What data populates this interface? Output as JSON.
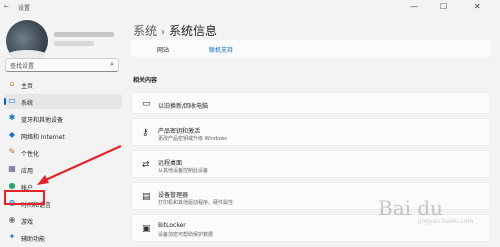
{
  "window": {
    "title": "设置",
    "back_glyph": "←",
    "minimize": "—",
    "maximize": "☐",
    "close": "✕"
  },
  "sidebar": {
    "search_placeholder": "查找设置",
    "items": [
      {
        "label": "主页",
        "icon": "home-icon",
        "glyph": "⌂",
        "color": "#d9822b"
      },
      {
        "label": "系统",
        "icon": "monitor-icon",
        "glyph": "▭",
        "color": "#0078d4"
      },
      {
        "label": "蓝牙和其他设备",
        "icon": "bluetooth-icon",
        "glyph": "✱",
        "color": "#0078d4"
      },
      {
        "label": "网络和 Internet",
        "icon": "wifi-icon",
        "glyph": "◆",
        "color": "#1a73c8"
      },
      {
        "label": "个性化",
        "icon": "paintbrush-icon",
        "glyph": "✎",
        "color": "#c06a2b"
      },
      {
        "label": "应用",
        "icon": "apps-icon",
        "glyph": "▦",
        "color": "#5a5a8a"
      },
      {
        "label": "帐户",
        "icon": "account-icon",
        "glyph": "●",
        "color": "#2fa36b"
      },
      {
        "label": "时间和语言",
        "icon": "globe-icon",
        "glyph": "◍",
        "color": "#1a73c8"
      },
      {
        "label": "游戏",
        "icon": "gamepad-icon",
        "glyph": "◉",
        "color": "#777777"
      },
      {
        "label": "辅助功能",
        "icon": "accessibility-icon",
        "glyph": "✦",
        "color": "#1a73c8"
      }
    ],
    "active_index": 1,
    "highlighted_index": 6
  },
  "main": {
    "breadcrumb_root": "系统",
    "breadcrumb_sep": "›",
    "breadcrumb_current": "系统信息",
    "site_key": "网站",
    "site_value": "联机支持",
    "section_title": "相关内容",
    "cards": [
      {
        "title": "以旧换新/回收电脑",
        "sub": "",
        "icon": "laptop-icon",
        "glyph": "▭"
      },
      {
        "title": "产品密钥和激活",
        "sub": "更改产品密钥或升级 Windows",
        "icon": "key-icon",
        "glyph": "⚷"
      },
      {
        "title": "远程桌面",
        "sub": "从其他设备控制此设备",
        "icon": "remote-desktop-icon",
        "glyph": "⇄"
      },
      {
        "title": "设备管理器",
        "sub": "打印机和其他驱动程序、硬件属性",
        "icon": "device-manager-icon",
        "glyph": "▤"
      },
      {
        "title": "BitLocker",
        "sub": "设备加密可帮助保护数据",
        "icon": "lock-icon",
        "glyph": "▣"
      }
    ]
  },
  "annotation_color": "#e4242b",
  "watermark": {
    "text": "Bai du",
    "sub": "jingyan.baidu.com"
  }
}
